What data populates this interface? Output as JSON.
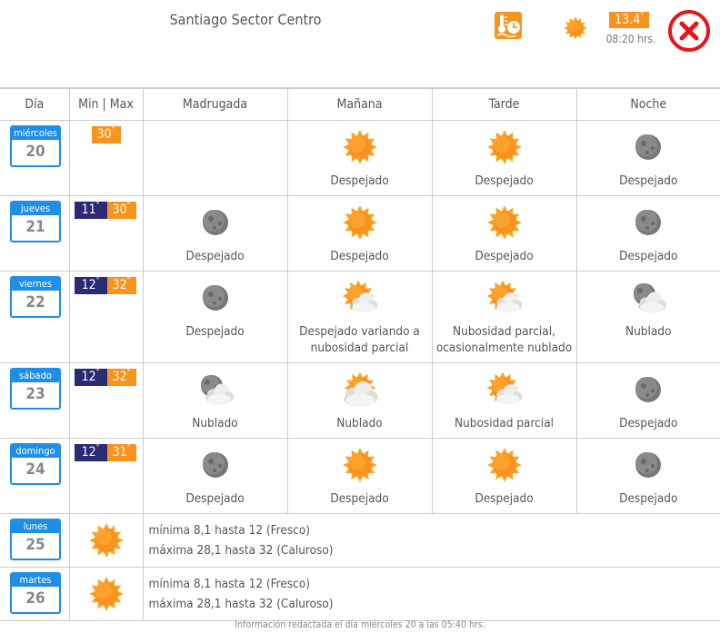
{
  "header": {
    "title": "Santiago Sector Centro",
    "current_temp": "13.4",
    "deg": "°",
    "time": "08:20 hrs."
  },
  "columns": [
    "Día",
    "Min | Max",
    "Madrugada",
    "Mañana",
    "Tarde",
    "Noche"
  ],
  "days": [
    {
      "name": "miércoles",
      "num": "20",
      "min": "",
      "max": "30",
      "deg": "°",
      "periods": [
        {
          "icon": "none",
          "label": ""
        },
        {
          "icon": "sun",
          "label": "Despejado"
        },
        {
          "icon": "sun",
          "label": "Despejado"
        },
        {
          "icon": "moon",
          "label": "Despejado"
        }
      ]
    },
    {
      "name": "jueves",
      "num": "21",
      "min": "11",
      "max": "30",
      "deg": "°",
      "periods": [
        {
          "icon": "moon",
          "label": "Despejado"
        },
        {
          "icon": "sun",
          "label": "Despejado"
        },
        {
          "icon": "sun",
          "label": "Despejado"
        },
        {
          "icon": "moon",
          "label": "Despejado"
        }
      ]
    },
    {
      "name": "viernes",
      "num": "22",
      "min": "12",
      "max": "32",
      "deg": "°",
      "periods": [
        {
          "icon": "moon",
          "label": "Despejado"
        },
        {
          "icon": "sun-cloud",
          "label": "Despejado variando a nubosidad parcial"
        },
        {
          "icon": "sun-cloud",
          "label": "Nubosidad parcial, ocasionalmente nublado"
        },
        {
          "icon": "moon-cloud",
          "label": "Nublado"
        }
      ]
    },
    {
      "name": "sábado",
      "num": "23",
      "min": "12",
      "max": "32",
      "deg": "°",
      "periods": [
        {
          "icon": "moon-cloud",
          "label": "Nublado"
        },
        {
          "icon": "sun-cloud-big",
          "label": "Nublado"
        },
        {
          "icon": "sun-cloud",
          "label": "Nubosidad parcial"
        },
        {
          "icon": "moon",
          "label": "Despejado"
        }
      ]
    },
    {
      "name": "domingo",
      "num": "24",
      "min": "12",
      "max": "31",
      "deg": "°",
      "periods": [
        {
          "icon": "moon",
          "label": "Despejado"
        },
        {
          "icon": "sun",
          "label": "Despejado"
        },
        {
          "icon": "sun",
          "label": "Despejado"
        },
        {
          "icon": "moon",
          "label": "Despejado"
        }
      ]
    }
  ],
  "summary_days": [
    {
      "name": "lunes",
      "num": "25",
      "icon": "sun",
      "min_text": "mínima 8,1 hasta 12 (Fresco)",
      "max_text": "máxima 28,1 hasta 32 (Caluroso)"
    },
    {
      "name": "martes",
      "num": "26",
      "icon": "sun",
      "min_text": "mínima 8,1 hasta 12 (Fresco)",
      "max_text": "máxima 28,1 hasta 32 (Caluroso)"
    }
  ],
  "footer": "Información redactada el día miércoles 20 a las 05:40 hrs.",
  "colors": {
    "accent_blue": "#1e8ee6",
    "orange": "#f7941d",
    "navy": "#2a2a75",
    "close_red": "#e8141b"
  }
}
